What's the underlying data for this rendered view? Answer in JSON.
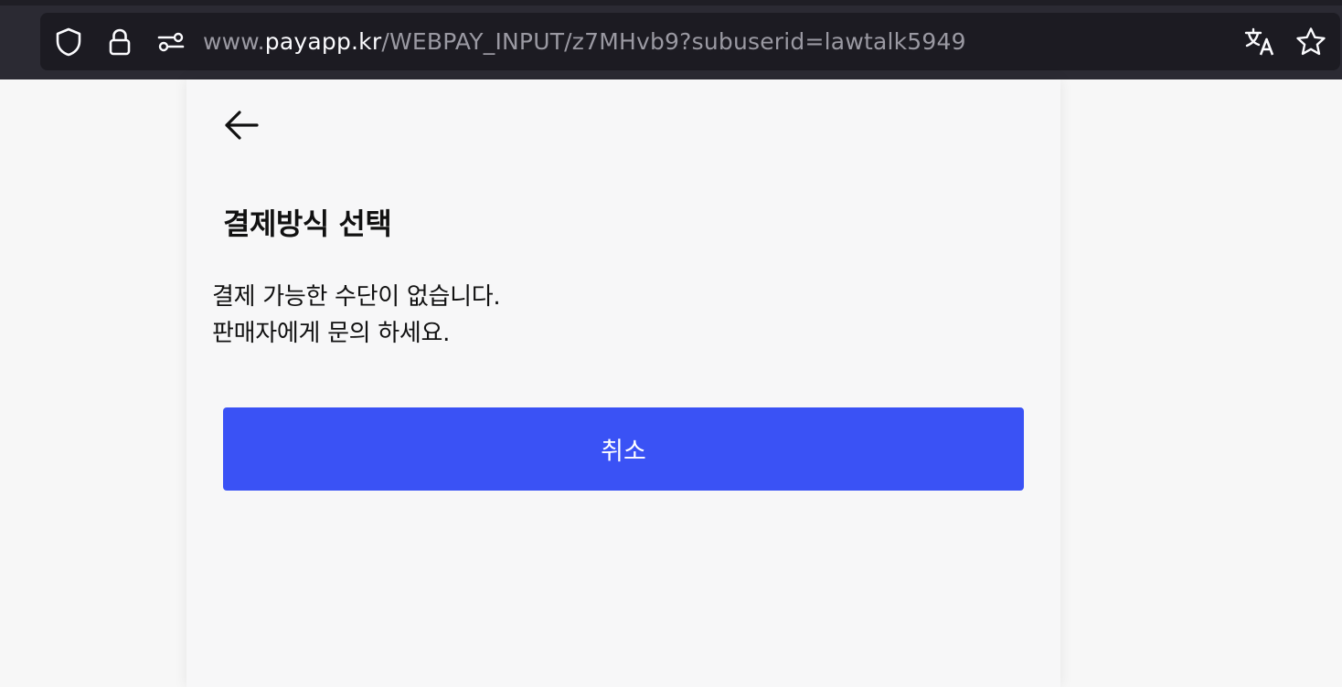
{
  "browser": {
    "url_prefix": "www.",
    "url_domain": "payapp.kr",
    "url_path": "/WEBPAY_INPUT/z7MHvb9?subuserid=lawtalk5949",
    "icons": [
      "shield-icon",
      "lock-icon",
      "permissions-icon",
      "translate-icon",
      "star-icon"
    ]
  },
  "page": {
    "title": "결제방식 선택",
    "message_line1": "결제 가능한 수단이 없습니다.",
    "message_line2": "판매자에게 문의 하세요.",
    "cancel_label": "취소"
  },
  "colors": {
    "accent": "#3a52f5",
    "browser_bg": "#2b2a33",
    "urlbar_bg": "#1c1b22",
    "page_bg": "#f7f7f7"
  }
}
